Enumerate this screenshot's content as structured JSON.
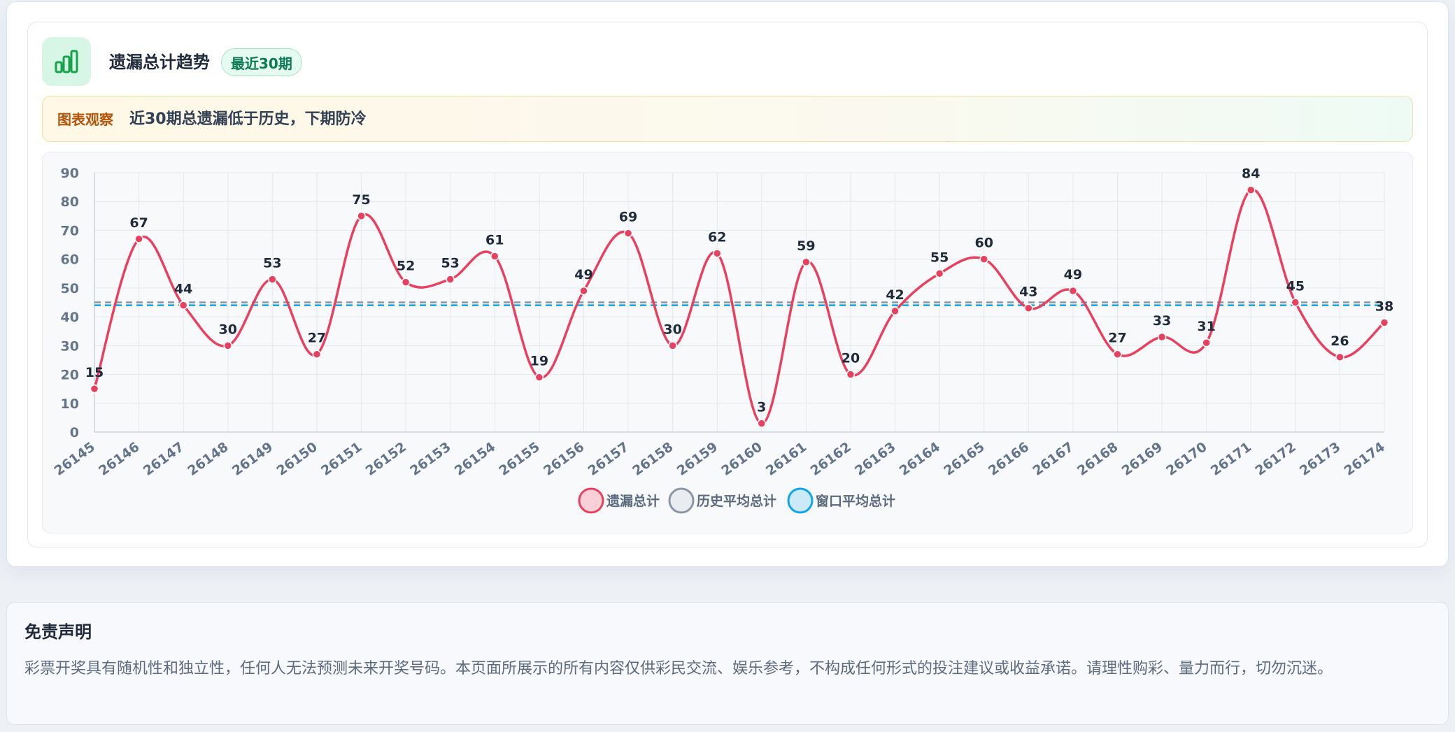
{
  "header": {
    "title": "遗漏总计趋势",
    "badge": "最近30期"
  },
  "insight": {
    "tag": "图表观察",
    "text": "近30期总遗漏低于历史，下期防冷"
  },
  "chart_data": {
    "type": "line",
    "title": "",
    "xlabel": "",
    "ylabel": "",
    "ylim": [
      0,
      90
    ],
    "yticks": [
      0,
      10,
      20,
      30,
      40,
      50,
      60,
      70,
      80,
      90
    ],
    "grid": true,
    "legend_position": "bottom-center",
    "categories": [
      "26145",
      "26146",
      "26147",
      "26148",
      "26149",
      "26150",
      "26151",
      "26152",
      "26153",
      "26154",
      "26155",
      "26156",
      "26157",
      "26158",
      "26159",
      "26160",
      "26161",
      "26162",
      "26163",
      "26164",
      "26165",
      "26166",
      "26167",
      "26168",
      "26169",
      "26170",
      "26171",
      "26172",
      "26173",
      "26174"
    ],
    "series": [
      {
        "name": "遗漏总计",
        "values": [
          15,
          67,
          44,
          30,
          53,
          27,
          75,
          52,
          53,
          61,
          19,
          49,
          69,
          30,
          62,
          3,
          59,
          20,
          42,
          55,
          60,
          43,
          49,
          27,
          33,
          31,
          84,
          45,
          26,
          38
        ],
        "color": "#e8405f",
        "style": "smooth-line-with-points-and-labels"
      },
      {
        "name": "历史平均总计",
        "value": 45,
        "color": "#8a96a6",
        "style": "dashed-horizontal"
      },
      {
        "name": "窗口平均总计",
        "value": 44,
        "color": "#0ea5e9",
        "style": "dashed-horizontal"
      }
    ]
  },
  "disclaimer": {
    "title": "免责声明",
    "text": "彩票开奖具有随机性和独立性，任何人无法预测未来开奖号码。本页面所展示的所有内容仅供彩民交流、娱乐参考，不构成任何形式的投注建议或收益承诺。请理性购彩、量力而行，切勿沉迷。"
  }
}
